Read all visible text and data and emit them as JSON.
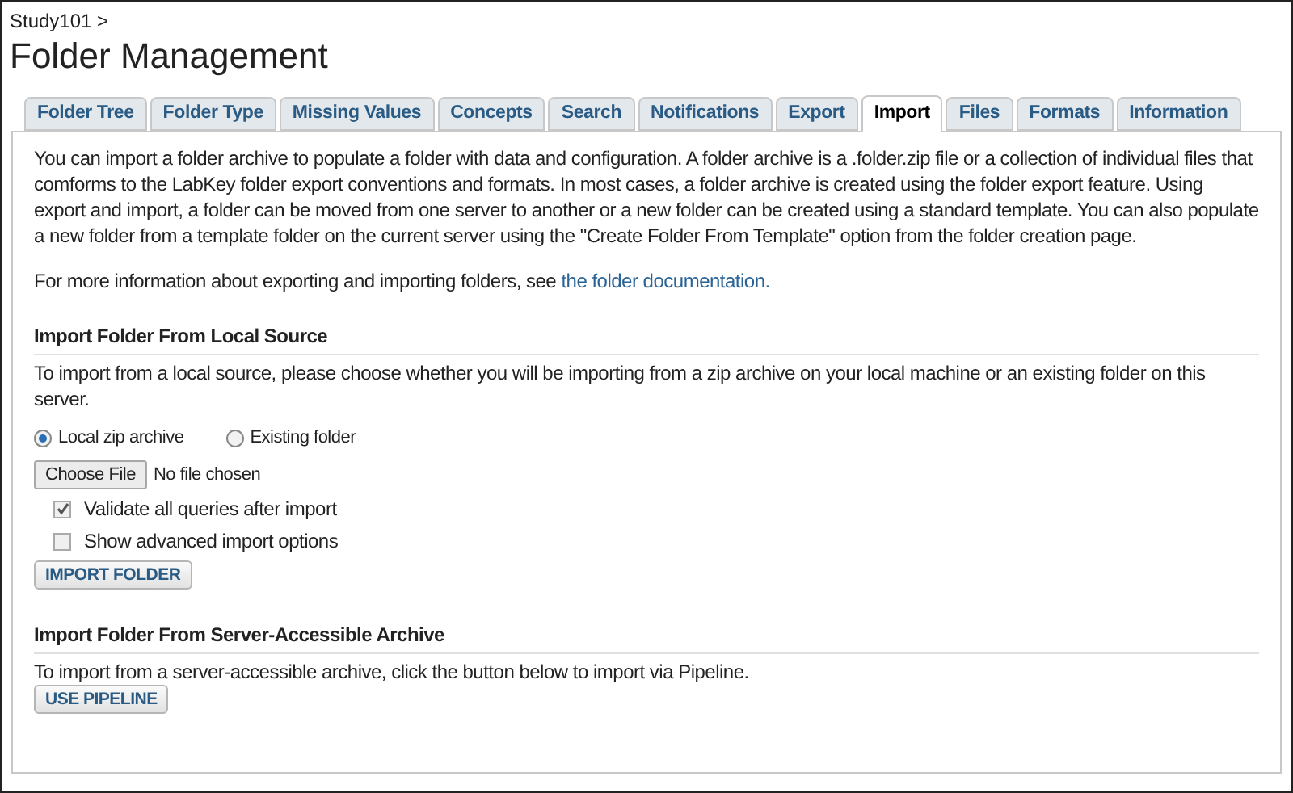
{
  "breadcrumb": "Study101 >",
  "title": "Folder Management",
  "tabs": [
    {
      "label": "Folder Tree",
      "selected": false
    },
    {
      "label": "Folder Type",
      "selected": false
    },
    {
      "label": "Missing Values",
      "selected": false
    },
    {
      "label": "Concepts",
      "selected": false
    },
    {
      "label": "Search",
      "selected": false
    },
    {
      "label": "Notifications",
      "selected": false
    },
    {
      "label": "Export",
      "selected": false
    },
    {
      "label": "Import",
      "selected": true
    },
    {
      "label": "Files",
      "selected": false
    },
    {
      "label": "Formats",
      "selected": false
    },
    {
      "label": "Information",
      "selected": false
    }
  ],
  "intro": "You can import a folder archive to populate a folder with data and configuration. A folder archive is a .folder.zip file or a collection of individual files that comforms to the LabKey folder export conventions and formats. In most cases, a folder archive is created using the folder export feature. Using export and import, a folder can be moved from one server to another or a new folder can be created using a standard template. You can also populate a new folder from a template folder on the current server using the \"Create Folder From Template\" option from the folder creation page.",
  "more_info": {
    "text": "For more information about exporting and importing folders, see",
    "link": "the folder documentation."
  },
  "local_section": {
    "heading": "Import Folder From Local Source",
    "description": "To import from a local source, please choose whether you will be importing from a zip archive on your local machine or an existing folder on this server.",
    "sources": [
      {
        "label": "Local zip archive",
        "selected": true
      },
      {
        "label": "Existing folder",
        "selected": false
      }
    ],
    "file_button": "Choose File",
    "file_status": "No file chosen",
    "options": [
      {
        "label": "Validate all queries after import",
        "checked": true
      },
      {
        "label": "Show advanced import options",
        "checked": false
      }
    ],
    "button": "IMPORT FOLDER"
  },
  "server_section": {
    "heading": "Import Folder From Server-Accessible Archive",
    "description": "To import from a server-accessible archive, click the button below to import via Pipeline.",
    "button": "USE PIPELINE"
  }
}
